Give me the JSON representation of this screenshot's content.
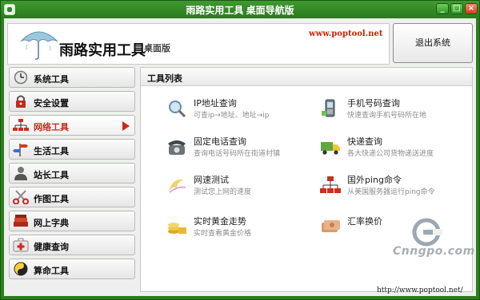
{
  "window": {
    "title": "雨路实用工具 桌面导航版"
  },
  "banner": {
    "brand": "雨路实用工具",
    "edition": "桌面版",
    "url": "www.poptool.net"
  },
  "exit_button": {
    "label": "退出系统"
  },
  "sidebar": {
    "items": [
      {
        "label": "系统工具",
        "icon": "clock-icon"
      },
      {
        "label": "安全设置",
        "icon": "lock-icon"
      },
      {
        "label": "网络工具",
        "icon": "network-icon",
        "active": true
      },
      {
        "label": "生活工具",
        "icon": "signpost-icon"
      },
      {
        "label": "站长工具",
        "icon": "user-icon"
      },
      {
        "label": "作图工具",
        "icon": "scissors-icon"
      },
      {
        "label": "网上字典",
        "icon": "books-icon"
      },
      {
        "label": "健康查询",
        "icon": "first-aid-icon"
      },
      {
        "label": "算命工具",
        "icon": "yin-yang-icon"
      }
    ]
  },
  "panel": {
    "title": "工具列表",
    "tools": [
      {
        "name": "IP地址查询",
        "desc": "可查ip→地址、地址→ip",
        "icon": "magnifier-icon"
      },
      {
        "name": "手机号码查询",
        "desc": "快速查询手机号码所在地",
        "icon": "mobile-phone-icon"
      },
      {
        "name": "固定电话查询",
        "desc": "查询电话号码所在街道村镇",
        "icon": "telephone-icon"
      },
      {
        "name": "快递查询",
        "desc": "各大快递公司货物递送进度",
        "icon": "truck-icon"
      },
      {
        "name": "网速测试",
        "desc": "测试您上网的速度",
        "icon": "swirl-icon"
      },
      {
        "name": "国外ping命令",
        "desc": "从美国服务器运行ping命令",
        "icon": "network-tree-icon"
      },
      {
        "name": "实时黄金走势",
        "desc": "实时查看黄金价格",
        "icon": "gold-icon"
      },
      {
        "name": "汇率换价",
        "desc": "",
        "icon": "currency-icon"
      }
    ]
  },
  "footer": {
    "url": "http://www.poptool.net/"
  },
  "watermark": {
    "text": "Cnngpo.com"
  },
  "colors": {
    "frame": "#2d7d1f",
    "accent_red": "#c52c1c",
    "url_red": "#cc2200",
    "desc_gray": "#8c8c8c"
  }
}
